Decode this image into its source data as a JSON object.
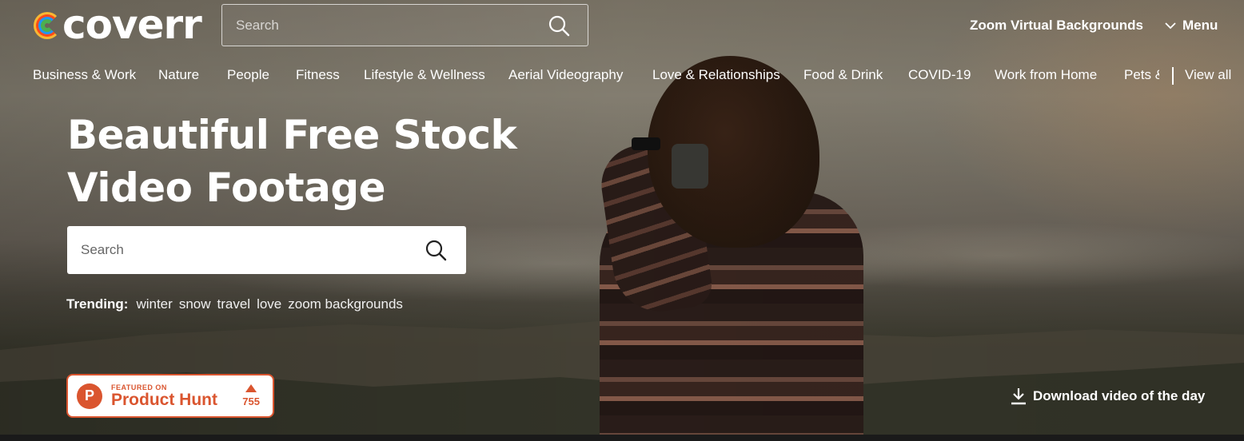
{
  "brand": {
    "name": "coverr",
    "logo_colors": [
      "#f7b733",
      "#fc4a1a",
      "#2196f3",
      "#4caf50"
    ]
  },
  "header": {
    "search_placeholder": "Search",
    "zoom_link": "Zoom Virtual Backgrounds",
    "menu_label": "Menu"
  },
  "categories": [
    "Business & Work",
    "Nature",
    "People",
    "Fitness",
    "Lifestyle & Wellness",
    "Aerial Videography",
    "Love & Relationships",
    "Food & Drink",
    "COVID-19",
    "Work from Home",
    "Pets &"
  ],
  "view_all": "View all",
  "hero": {
    "title_line1": "Beautiful Free Stock",
    "title_line2": "Video Footage",
    "search_placeholder": "Search"
  },
  "trending": {
    "label": "Trending:",
    "tags": [
      "winter",
      "snow",
      "travel",
      "love",
      "zoom backgrounds"
    ]
  },
  "product_hunt": {
    "featured_on": "FEATURED ON",
    "name": "Product Hunt",
    "logo_letter": "P",
    "votes": "755",
    "color": "#da552f"
  },
  "download_label": "Download video of the day"
}
